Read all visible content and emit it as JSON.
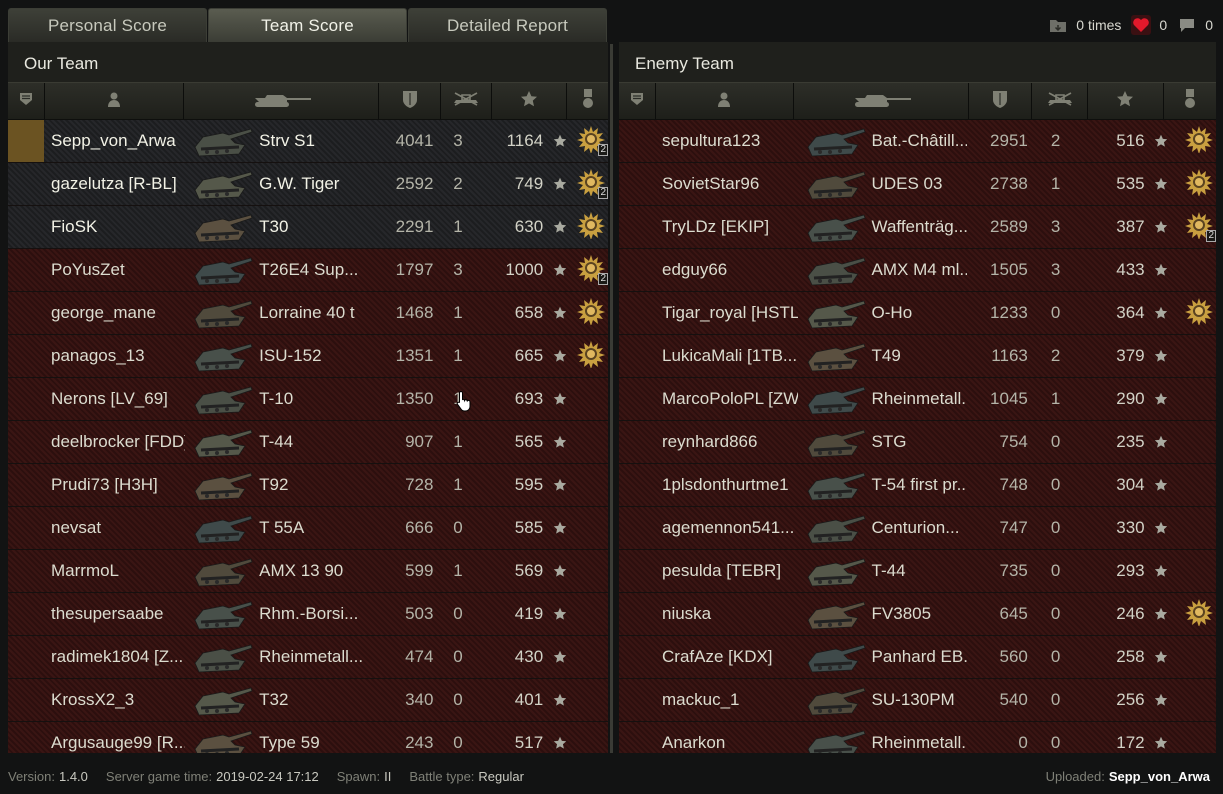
{
  "tabs": [
    {
      "label": "Personal Score",
      "active": false
    },
    {
      "label": "Team Score",
      "active": true
    },
    {
      "label": "Detailed Report",
      "active": false
    }
  ],
  "counters": {
    "views": "0 times",
    "likes": "0",
    "comments": "0"
  },
  "our_team": {
    "title": "Our Team",
    "rows": [
      {
        "player": "Sepp_von_Arwa",
        "tank": "Strv S1",
        "damage": "4041",
        "kills": "3",
        "xp": "1164",
        "medal": true,
        "medal_count": "2",
        "team": true,
        "me": true
      },
      {
        "player": "gazelutza [R-BL]",
        "tank": "G.W. Tiger",
        "damage": "2592",
        "kills": "2",
        "xp": "749",
        "medal": true,
        "medal_count": "2",
        "team": true
      },
      {
        "player": "FioSK",
        "tank": "T30",
        "damage": "2291",
        "kills": "1",
        "xp": "630",
        "medal": true,
        "medal_count": "",
        "team": true
      },
      {
        "player": "PoYusZet",
        "tank": "T26E4 Sup...",
        "damage": "1797",
        "kills": "3",
        "xp": "1000",
        "medal": true,
        "medal_count": "2"
      },
      {
        "player": "george_mane",
        "tank": "Lorraine 40 t",
        "damage": "1468",
        "kills": "1",
        "xp": "658",
        "medal": true,
        "medal_count": ""
      },
      {
        "player": "panagos_13",
        "tank": "ISU-152",
        "damage": "1351",
        "kills": "1",
        "xp": "665",
        "medal": true,
        "medal_count": ""
      },
      {
        "player": "Nerons [LV_69]",
        "tank": "T-10",
        "damage": "1350",
        "kills": "1",
        "xp": "693",
        "medal": false,
        "medal_count": ""
      },
      {
        "player": "deelbrocker [FDD]",
        "tank": "T-44",
        "damage": "907",
        "kills": "1",
        "xp": "565",
        "medal": false,
        "medal_count": ""
      },
      {
        "player": "Prudi73 [H3H]",
        "tank": "T92",
        "damage": "728",
        "kills": "1",
        "xp": "595",
        "medal": false,
        "medal_count": ""
      },
      {
        "player": "nevsat",
        "tank": "T 55A",
        "damage": "666",
        "kills": "0",
        "xp": "585",
        "medal": false,
        "medal_count": ""
      },
      {
        "player": "MarrmoL",
        "tank": "AMX 13 90",
        "damage": "599",
        "kills": "1",
        "xp": "569",
        "medal": false,
        "medal_count": ""
      },
      {
        "player": "thesupersaabe",
        "tank": "Rhm.-Borsi...",
        "damage": "503",
        "kills": "0",
        "xp": "419",
        "medal": false,
        "medal_count": ""
      },
      {
        "player": "radimek1804 [Z...",
        "tank": "Rheinmetall...",
        "damage": "474",
        "kills": "0",
        "xp": "430",
        "medal": false,
        "medal_count": ""
      },
      {
        "player": "KrossX2_3",
        "tank": "T32",
        "damage": "340",
        "kills": "0",
        "xp": "401",
        "medal": false,
        "medal_count": ""
      },
      {
        "player": "Argusauge99 [R...",
        "tank": "Type 59",
        "damage": "243",
        "kills": "0",
        "xp": "517",
        "medal": false,
        "medal_count": ""
      }
    ]
  },
  "enemy_team": {
    "title": "Enemy Team",
    "rows": [
      {
        "player": "sepultura123",
        "tank": "Bat.-Châtill...",
        "damage": "2951",
        "kills": "2",
        "xp": "516",
        "medal": true,
        "medal_count": ""
      },
      {
        "player": "SovietStar96",
        "tank": "UDES 03",
        "damage": "2738",
        "kills": "1",
        "xp": "535",
        "medal": true,
        "medal_count": ""
      },
      {
        "player": "TryLDz [EKIP]",
        "tank": "Waffenträg...",
        "damage": "2589",
        "kills": "3",
        "xp": "387",
        "medal": true,
        "medal_count": "2"
      },
      {
        "player": "edguy66",
        "tank": "AMX M4 ml...",
        "damage": "1505",
        "kills": "3",
        "xp": "433",
        "medal": false,
        "medal_count": ""
      },
      {
        "player": "Tigar_royal [HSTL]",
        "tank": "O-Ho",
        "damage": "1233",
        "kills": "0",
        "xp": "364",
        "medal": true,
        "medal_count": ""
      },
      {
        "player": "LukicaMali [1TB...",
        "tank": "T49",
        "damage": "1163",
        "kills": "2",
        "xp": "379",
        "medal": false,
        "medal_count": ""
      },
      {
        "player": "MarcoPoloPL [ZW]",
        "tank": "Rheinmetall...",
        "damage": "1045",
        "kills": "1",
        "xp": "290",
        "medal": false,
        "medal_count": ""
      },
      {
        "player": "reynhard866",
        "tank": "STG",
        "damage": "754",
        "kills": "0",
        "xp": "235",
        "medal": false,
        "medal_count": ""
      },
      {
        "player": "1plsdonthurtme1",
        "tank": "T-54 first pr...",
        "damage": "748",
        "kills": "0",
        "xp": "304",
        "medal": false,
        "medal_count": ""
      },
      {
        "player": "agemennon541...",
        "tank": "Centurion...",
        "damage": "747",
        "kills": "0",
        "xp": "330",
        "medal": false,
        "medal_count": ""
      },
      {
        "player": "pesulda [TEBR]",
        "tank": "T-44",
        "damage": "735",
        "kills": "0",
        "xp": "293",
        "medal": false,
        "medal_count": ""
      },
      {
        "player": "niuska",
        "tank": "FV3805",
        "damage": "645",
        "kills": "0",
        "xp": "246",
        "medal": true,
        "medal_count": ""
      },
      {
        "player": "CrafAze [KDX]",
        "tank": "Panhard EB...",
        "damage": "560",
        "kills": "0",
        "xp": "258",
        "medal": false,
        "medal_count": ""
      },
      {
        "player": "mackuc_1",
        "tank": "SU-130PM",
        "damage": "540",
        "kills": "0",
        "xp": "256",
        "medal": false,
        "medal_count": ""
      },
      {
        "player": "Anarkon",
        "tank": "Rheinmetall...",
        "damage": "0",
        "kills": "0",
        "xp": "172",
        "medal": false,
        "medal_count": ""
      }
    ]
  },
  "footer": {
    "version_label": "Version:",
    "version": "1.4.0",
    "time_label": "Server game time:",
    "time": "2019-02-24 17:12",
    "spawn_label": "Spawn:",
    "spawn": "II",
    "battle_label": "Battle type:",
    "battle": "Regular",
    "uploaded_label": "Uploaded:",
    "uploaded": "Sepp_von_Arwa"
  },
  "colors": {
    "team_row": "#26272a",
    "enemy_row": "#3a1513",
    "me_highlight": "#6b5322",
    "medal_gold": "#c9a040"
  }
}
